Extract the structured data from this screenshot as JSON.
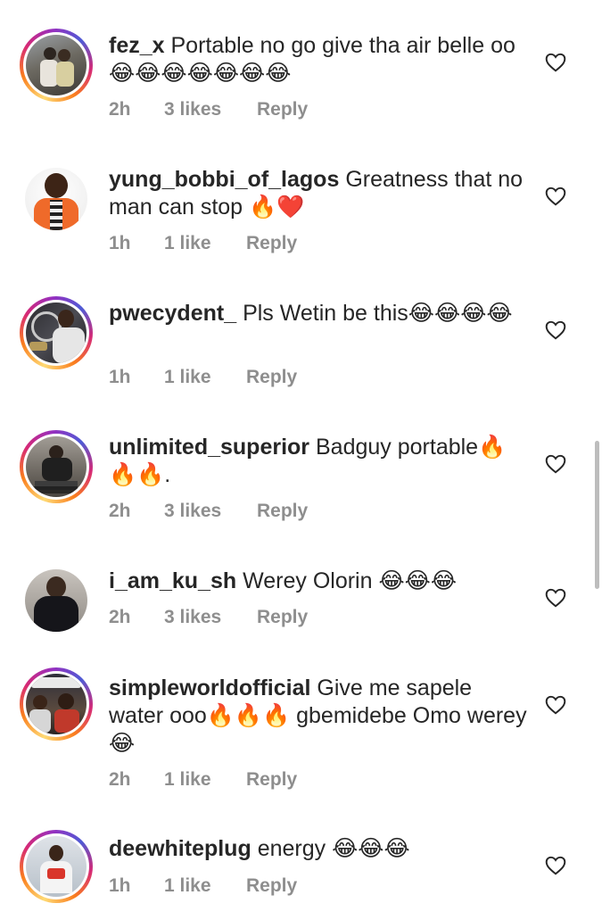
{
  "comments": [
    {
      "username": "fez_x",
      "text": "Portable no go give tha air belle oo 😂😂😂😂😂😂😂",
      "time": "2h",
      "likes": "3 likes",
      "reply": "Reply"
    },
    {
      "username": "yung_bobbi_of_lagos",
      "text": "Greatness that no man can stop 🔥❤️",
      "time": "1h",
      "likes": "1 like",
      "reply": "Reply"
    },
    {
      "username": "pwecydent_",
      "text": "Pls Wetin be this😂😂😂😂",
      "time": "1h",
      "likes": "1 like",
      "reply": "Reply"
    },
    {
      "username": "unlimited_superior",
      "text": "Badguy portable🔥🔥🔥.",
      "time": "2h",
      "likes": "3 likes",
      "reply": "Reply"
    },
    {
      "username": "i_am_ku_sh",
      "text": "Werey Olorin 😂😂😂",
      "time": "2h",
      "likes": "3 likes",
      "reply": "Reply"
    },
    {
      "username": "simpleworldofficial",
      "text": "Give me sapele water ooo🔥🔥🔥 gbemidebe Omo werey😂",
      "time": "2h",
      "likes": "1 like",
      "reply": "Reply"
    },
    {
      "username": "deewhiteplug",
      "text": "energy 😂😂😂",
      "time": "1h",
      "likes": "1 like",
      "reply": "Reply"
    }
  ],
  "icons": {
    "like": "heart-outline-icon"
  },
  "colors": {
    "text": "#262626",
    "meta": "#8e8e8e"
  }
}
